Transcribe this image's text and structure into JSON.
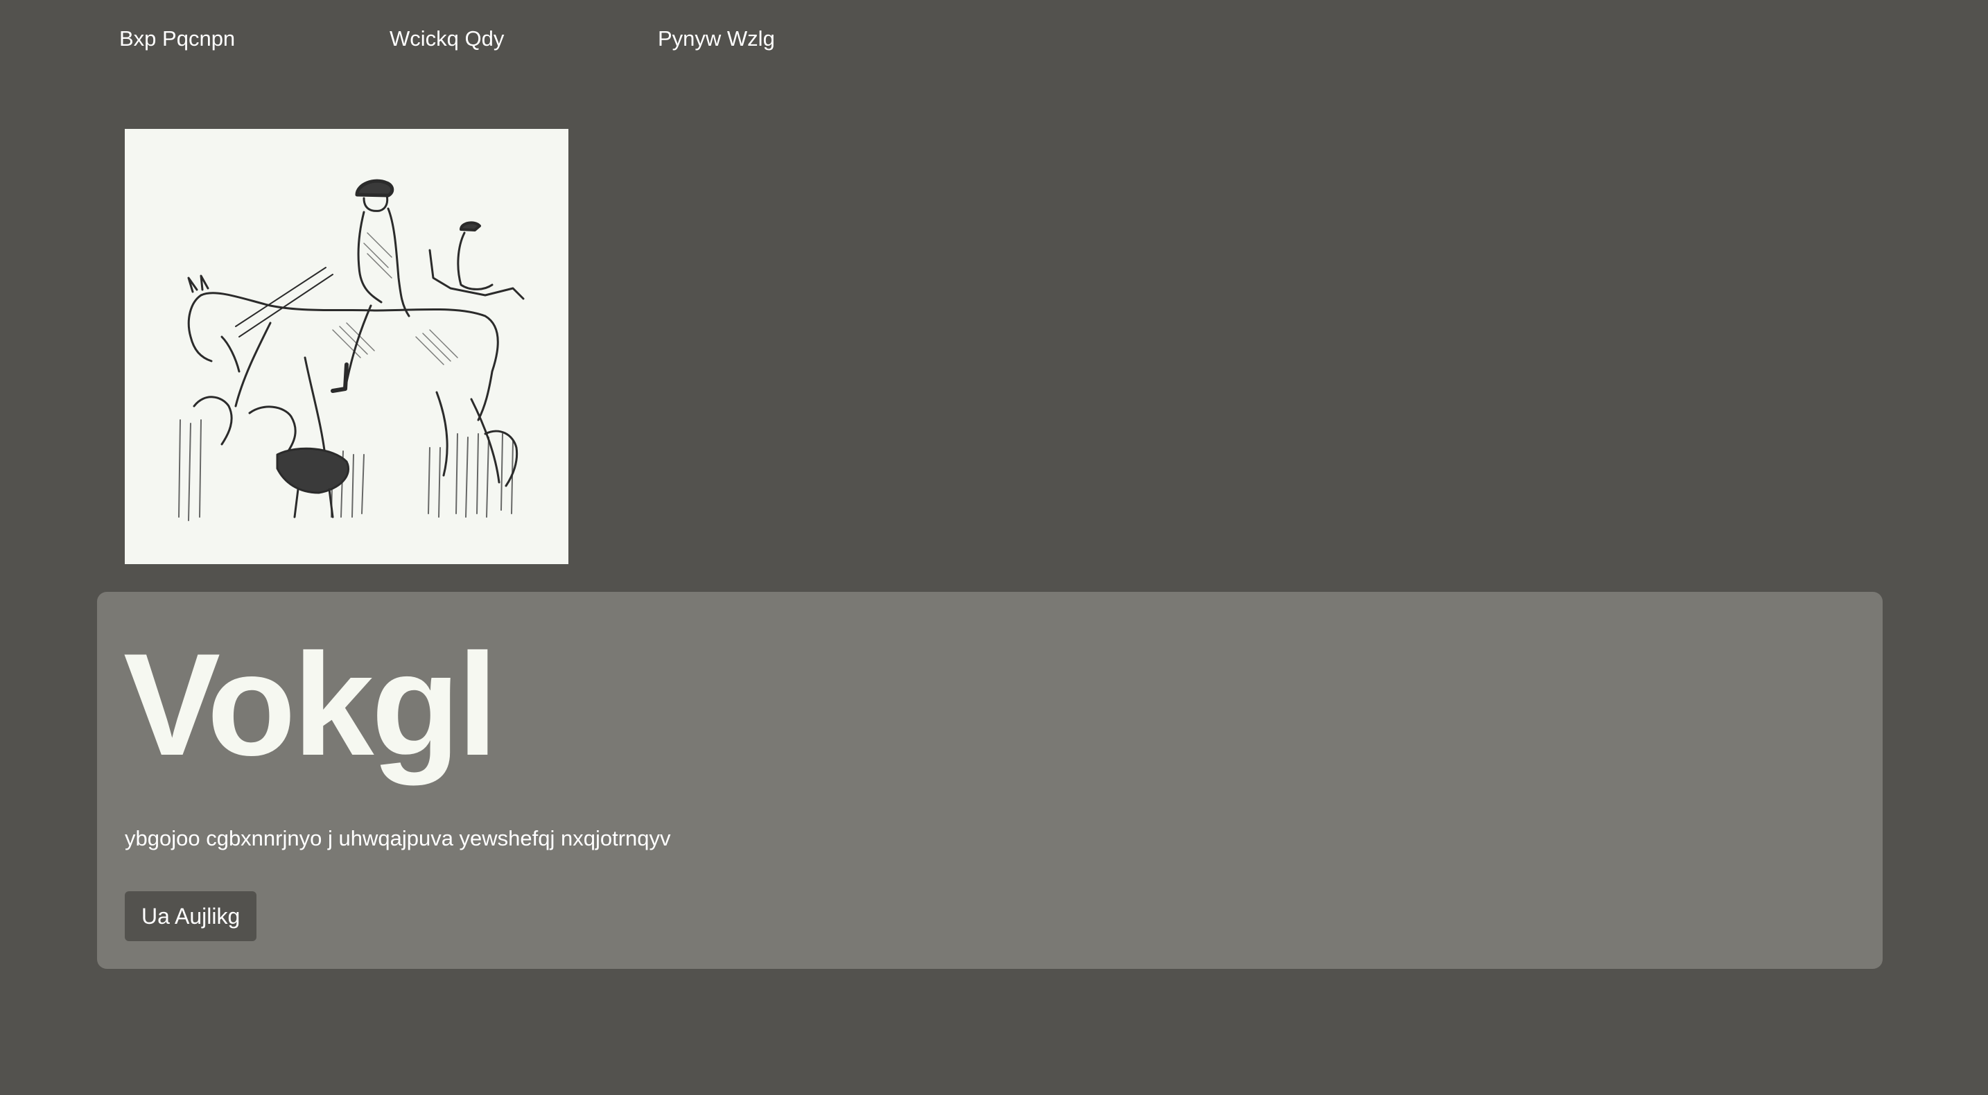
{
  "nav": {
    "items": [
      {
        "label": "Bxp Pqcnpn"
      },
      {
        "label": "Wcickq Qdy"
      },
      {
        "label": "Pynyw Wzlg"
      }
    ]
  },
  "hero": {
    "title": "Vokgl",
    "text": "ybgojoo cgbxnnrjnyo j uhwqajpuva yewshefqj nxqjotrnqyv",
    "button_label": "Ua Aujlikg"
  },
  "colors": {
    "background": "#53524e",
    "card": "#7a7974",
    "title": "#f6f8f1",
    "button": "#53524e",
    "artwork_paper": "#f5f7f2"
  }
}
